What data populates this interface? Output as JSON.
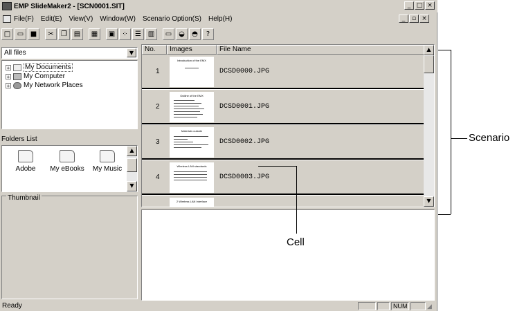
{
  "window": {
    "title": "EMP SlideMaker2 - [SCN0001.SIT]",
    "controls": [
      "_",
      "□",
      "×"
    ],
    "doc_controls": [
      "_",
      "▫",
      "×"
    ]
  },
  "menu": [
    "File(F)",
    "Edit(E)",
    "View(V)",
    "Window(W)",
    "Scenario Option(S)",
    "Help(H)"
  ],
  "toolbar": [
    "new-icon",
    "open-icon",
    "save-icon",
    "cut-icon",
    "copy-icon",
    "paste-icon",
    "print-icon",
    "large-icons-icon",
    "small-icons-icon",
    "list-icon",
    "details-icon",
    "monitor-icon",
    "send-icon",
    "export-icon",
    "help-icon"
  ],
  "left": {
    "dropdown_value": "All files",
    "tree": [
      "My Documents",
      "My Computer",
      "My Network Places"
    ],
    "folders_label": "Folders List",
    "folders": [
      "Adobe",
      "My eBooks",
      "My Music"
    ],
    "thumbnail_label": "Thumbnail"
  },
  "scenario": {
    "columns": [
      "No.",
      "Images",
      "File Name"
    ],
    "rows": [
      {
        "no": "1",
        "file": "DCSD0000.JPG",
        "slide_title": "Introduction of the EMX"
      },
      {
        "no": "2",
        "file": "DCSD0001.JPG",
        "slide_title": "Outline of the EMX"
      },
      {
        "no": "3",
        "file": "DCSD0002.JPG",
        "slide_title": "Materials outside"
      },
      {
        "no": "4",
        "file": "DCSD0003.JPG",
        "slide_title": "Wireless LAN standards"
      },
      {
        "no": "",
        "file": "",
        "slide_title": "2 Wireless LAN Interface"
      }
    ]
  },
  "status": {
    "text": "Ready",
    "num": "NUM"
  },
  "callouts": {
    "scenario": "Scenario",
    "cell": "Cell"
  }
}
